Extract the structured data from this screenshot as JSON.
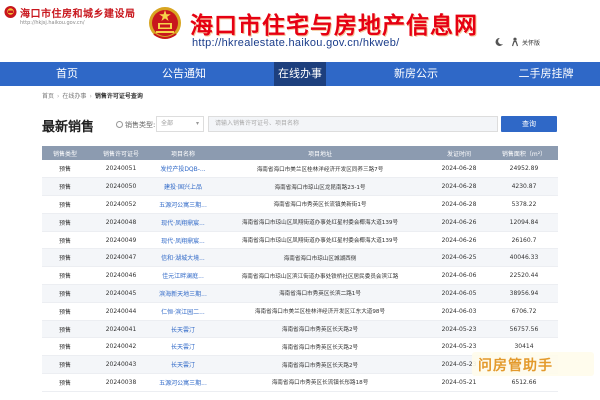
{
  "header": {
    "brand_name": "海口市住房和城乡建设局",
    "brand_url": "http://hkjsj.haikou.gov.cn/",
    "site_title": "海口市住宅与房地产信息网",
    "site_url": "http://hkrealestate.haikou.gov.cn/hkweb/",
    "elder_mode_label": "关怀版"
  },
  "nav": {
    "items": [
      {
        "label": "首页"
      },
      {
        "label": "公告通知"
      },
      {
        "label": "在线办事",
        "active": true
      },
      {
        "label": "新房公示"
      },
      {
        "label": "二手房挂牌"
      }
    ]
  },
  "breadcrumb": {
    "items": [
      "首页",
      "在线办事",
      "销售许可证号查询"
    ]
  },
  "section": {
    "title": "最新销售",
    "filter_label": "销售类型:",
    "type_select_value": "全部",
    "search_placeholder": "请输入销售许可证号、项目名称",
    "search_button": "查询"
  },
  "table": {
    "headers": [
      "销售类型",
      "销售许可证号",
      "项目名称",
      "项目地址",
      "发证时间",
      "销售面积（m²）"
    ],
    "rows": [
      [
        "预售",
        "20240051",
        "发控产投DQB-...",
        "海南省海口市美兰区桂林洋经济开发区同养三路7号",
        "2024-06-28",
        "24952.89"
      ],
      [
        "预售",
        "20240050",
        "建投·国兴上品",
        "海南省海口市琼山区龙昆南路23-1号",
        "2024-06-28",
        "4230.87"
      ],
      [
        "预售",
        "20240052",
        "五源河公寓三期...",
        "海南省海口市秀英区长流镇美新街1号",
        "2024-06-28",
        "5378.22"
      ],
      [
        "预售",
        "20240048",
        "现代·凤翔鼎宸...",
        "海南省海口市琼山区凤翔街道办事处红星村委会椰海大道139号",
        "2024-06-26",
        "12094.84"
      ],
      [
        "预售",
        "20240049",
        "现代·凤翔鼎宸...",
        "海南省海口市琼山区凤翔街道办事处红星村委会椰海大道139号",
        "2024-06-26",
        "26160.7"
      ],
      [
        "预售",
        "20240047",
        "信和·湖城大境...",
        "海南省海口市琼山区城湖西侧",
        "2024-06-25",
        "40046.33"
      ],
      [
        "预售",
        "20240046",
        "佳元江畔澜庭...",
        "海南省海口市琼山区滨江街道办事处铁桥社区居民委员会滨江路",
        "2024-06-06",
        "22520.44"
      ],
      [
        "预售",
        "20240045",
        "滨海新天地三期...",
        "海南省海口市秀英区长滨二路1号",
        "2024-06-05",
        "38956.94"
      ],
      [
        "预售",
        "20240044",
        "仁恒·滨江园二...",
        "海南省海口市美兰区桂林洋经济开发区江东大道98号",
        "2024-06-03",
        "6706.72"
      ],
      [
        "预售",
        "20240041",
        "长天雲汀",
        "海南省海口市秀英区长天路2号",
        "2024-05-23",
        "56757.56"
      ],
      [
        "预售",
        "20240042",
        "长天雲汀",
        "海南省海口市秀英区长天路2号",
        "2024-05-23",
        "30414"
      ],
      [
        "预售",
        "20240043",
        "长天雲汀",
        "海南省海口市秀英区长天路2号",
        "2024-05-23",
        ""
      ],
      [
        "预售",
        "20240038",
        "五源河公寓三期...",
        "海南省海口市秀英区长流镇长彤路18号",
        "2024-05-21",
        "6512.66"
      ]
    ]
  },
  "watermark": {
    "text": "问房管助手"
  },
  "colors": {
    "brand_red": "#e60012",
    "nav_blue": "#2f68c7",
    "nav_active": "#1d3f7d",
    "table_header": "#8c9bb0",
    "watermark_orange": "#e39a2c"
  },
  "icons": [
    "emblem-icon",
    "national-emblem-icon",
    "contrast-icon",
    "elder-mode-icon",
    "radio-icon",
    "chevron-down-icon"
  ]
}
